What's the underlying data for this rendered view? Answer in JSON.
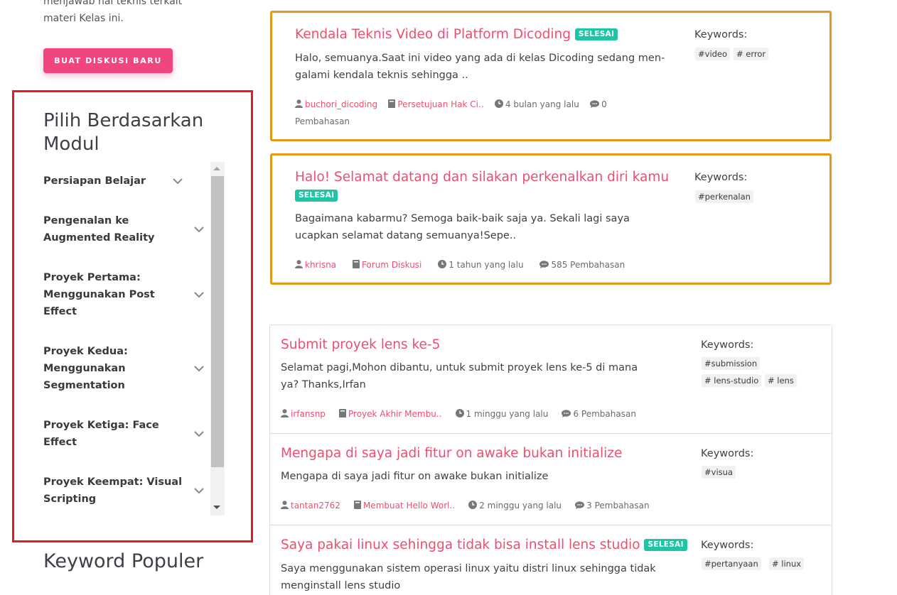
{
  "sidebar": {
    "intro_lines": [
      "menjawab hal teknis terkait",
      "materi Kelas ini."
    ],
    "new_discussion_button": "BUAT DISKUSI BARU",
    "module_section_title_lines": [
      "Pilih Berdasarkan",
      "Modul"
    ],
    "modules": [
      {
        "lines": [
          "Persiapan Belajar"
        ]
      },
      {
        "lines": [
          "Pengenalan ke",
          "Augmented Reality"
        ]
      },
      {
        "lines": [
          "Proyek Pertama:",
          "Menggunakan Post",
          "Effect"
        ]
      },
      {
        "lines": [
          "Proyek Kedua:",
          "Menggunakan",
          "Segmentation"
        ]
      },
      {
        "lines": [
          "Proyek Ketiga: Face",
          "Effect"
        ]
      },
      {
        "lines": [
          "Proyek Keempat: Visual",
          "Scripting"
        ]
      }
    ],
    "keyword_section_title": "Keyword Populer"
  },
  "keywords_label": "Keywords:",
  "threads": [
    {
      "title": "Kendala Teknis Video di Platform Dicoding",
      "badge": "SELESAI",
      "excerpt_lines": [
        "Halo, semuanya.Saat ini video yang ada di kelas Dicoding sedang men-",
        "galami kendala teknis sehingga .."
      ],
      "author": "buchori_dicoding",
      "module": "Persetujuan Hak Ci..",
      "time": "4 bulan yang lalu",
      "replies": "0",
      "replies_label": "Pembahasan",
      "tags": [
        "#video",
        "# error"
      ]
    },
    {
      "title": "Halo! Selamat datang dan silakan perkenalkan diri kamu",
      "badge": "SELESAI",
      "excerpt_lines": [
        "Bagaimana kabarmu? Semoga baik-baik saja ya. Sekali lagi saya",
        "ucapkan selamat datang semuanya!Sepe.."
      ],
      "author": "khrisna",
      "module": "Forum Diskusi",
      "time": "1 tahun yang lalu",
      "replies": "585 Pembahasan",
      "tags": [
        "#perkenalan"
      ]
    },
    {
      "title": "Submit proyek lens ke-5",
      "excerpt_lines": [
        "Selamat pagi,Mohon dibantu, untuk submit proyek lens ke-5 di mana",
        "ya? Thanks,Irfan"
      ],
      "author": "irfansnp",
      "module": "Proyek Akhir Membu..",
      "time": "1 minggu yang lalu",
      "replies": "6 Pembahasan",
      "tags": [
        "#submission",
        "# lens-studio",
        "# lens"
      ]
    },
    {
      "title": "Mengapa di saya jadi fitur on awake bukan initialize",
      "excerpt_lines": [
        "Mengapa di saya jadi fitur on awake bukan initialize"
      ],
      "author": "tantan2762",
      "module": "Membuat Hello Worl..",
      "time": "2 minggu yang lalu",
      "replies": "3 Pembahasan",
      "tags": [
        "#visua"
      ]
    },
    {
      "title": "Saya pakai linux sehingga tidak bisa install lens studio",
      "badge": "SELESAI",
      "excerpt_lines": [
        "Saya menggunakan sistem operasi linux yaitu distri linux sehingga tidak",
        "menginstall lens studio"
      ],
      "tags": [
        "#pertanyaan",
        "# linux"
      ]
    }
  ],
  "colors": {
    "accent": "#f0467d",
    "link": "#ee4e72",
    "highlight_border": "#e29a15",
    "badge": "#1ec5a5",
    "annotation_box": "#e31b23"
  }
}
